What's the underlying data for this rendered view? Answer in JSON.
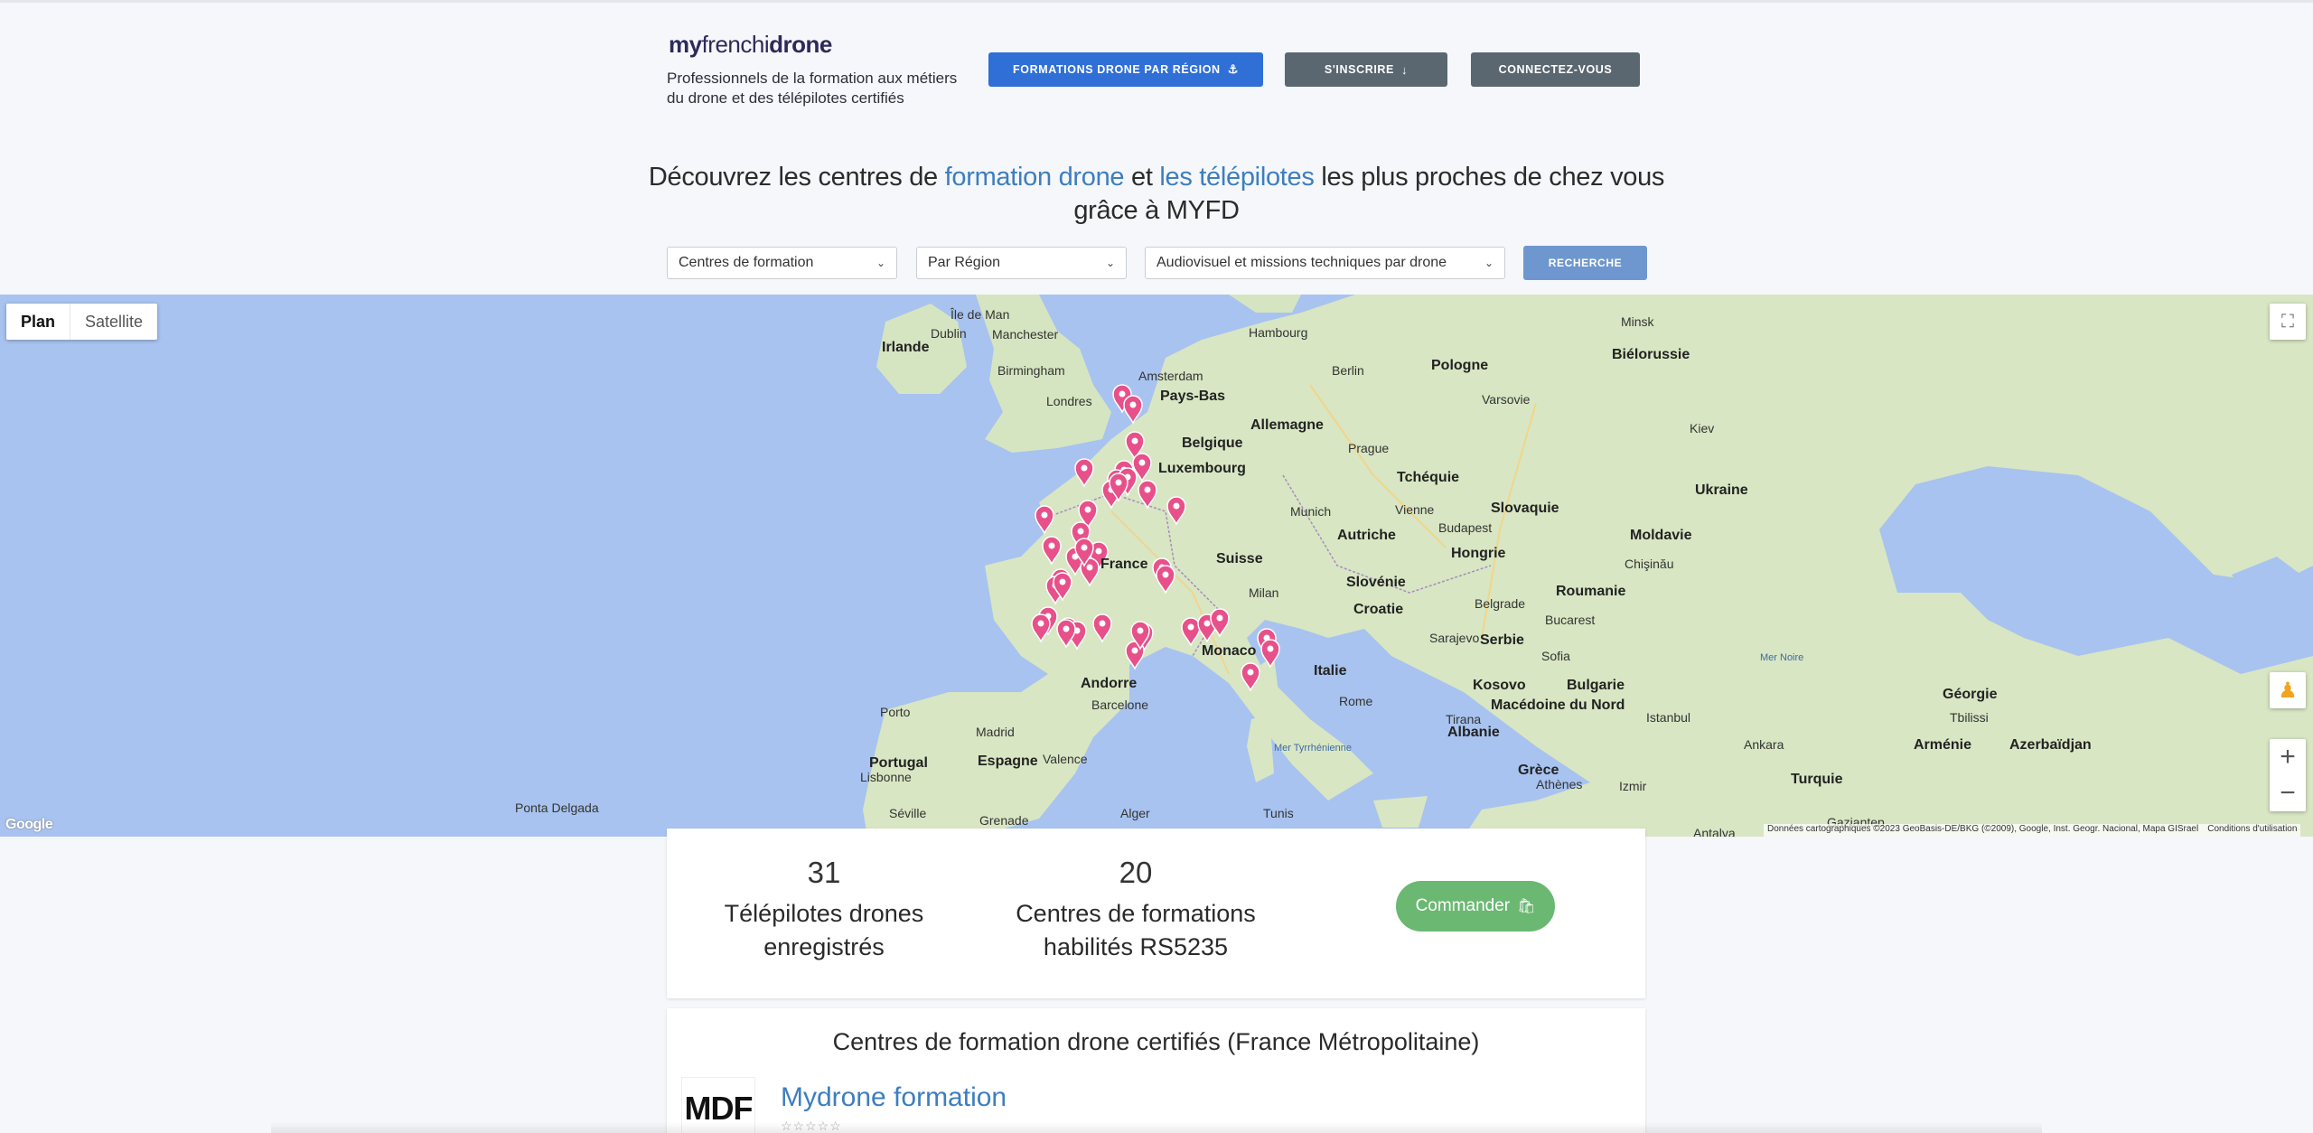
{
  "header": {
    "logo_my": "my",
    "logo_french": "frenchi",
    "logo_drone": "drone",
    "tagline": "Professionnels de la formation aux métiers du drone et des télépilotes certifiés",
    "btn_formations": "FORMATIONS DRONE PAR RÉGION",
    "btn_inscrire": "S'INSCRIRE",
    "btn_connect": "CONNECTEZ-VOUS"
  },
  "headline": {
    "part1": "Découvrez les centres de ",
    "link1": "formation drone",
    "part2": " et ",
    "link2": "les télépilotes",
    "part3": " les plus proches de chez vous grâce à MYFD"
  },
  "filters": {
    "type": "Centres de formation",
    "region": "Par Région",
    "activity": "Audiovisuel et missions techniques par drone",
    "search_label": "RECHERCHE"
  },
  "map": {
    "toggle_plan": "Plan",
    "toggle_satellite": "Satellite",
    "google": "Google",
    "attribution": "Données cartographiques ©2023 GeoBasis-DE/BKG (©2009), Google, Inst. Geogr. Nacional, Mapa GISrael",
    "terms": "Conditions d'utilisation",
    "labels": [
      {
        "t": "Île de Man"
      },
      {
        "t": "Dublin"
      },
      {
        "t": "Irlande"
      },
      {
        "t": "Manchester"
      },
      {
        "t": "Birmingham"
      },
      {
        "t": "Londres"
      },
      {
        "t": "Amsterdam"
      },
      {
        "t": "Pays-Bas"
      },
      {
        "t": "Hambourg"
      },
      {
        "t": "Berlin"
      },
      {
        "t": "Pologne"
      },
      {
        "t": "Varsovie"
      },
      {
        "t": "Minsk"
      },
      {
        "t": "Biélorussie"
      },
      {
        "t": "Belgique"
      },
      {
        "t": "Allemagne"
      },
      {
        "t": "Luxembourg"
      },
      {
        "t": "Prague"
      },
      {
        "t": "Tchéquie"
      },
      {
        "t": "Kiev"
      },
      {
        "t": "Ukraine"
      },
      {
        "t": "Slovaquie"
      },
      {
        "t": "Munich"
      },
      {
        "t": "Vienne"
      },
      {
        "t": "Autriche"
      },
      {
        "t": "Budapest"
      },
      {
        "t": "Hongrie"
      },
      {
        "t": "Moldavie"
      },
      {
        "t": "France"
      },
      {
        "t": "Suisse"
      },
      {
        "t": "Milan"
      },
      {
        "t": "Slovénie"
      },
      {
        "t": "Croatie"
      },
      {
        "t": "Belgrade"
      },
      {
        "t": "Roumanie"
      },
      {
        "t": "Bucarest"
      },
      {
        "t": "Serbie"
      },
      {
        "t": "Sarajevo"
      },
      {
        "t": "Monaco"
      },
      {
        "t": "Italie"
      },
      {
        "t": "Andorre"
      },
      {
        "t": "Barcelone"
      },
      {
        "t": "Kosovo"
      },
      {
        "t": "Sofia"
      },
      {
        "t": "Bulgarie"
      },
      {
        "t": "Rome"
      },
      {
        "t": "Porto"
      },
      {
        "t": "Madrid"
      },
      {
        "t": "Espagne"
      },
      {
        "t": "Valence"
      },
      {
        "t": "Portugal"
      },
      {
        "t": "Lisbonne"
      },
      {
        "t": "Tirana"
      },
      {
        "t": "Albanie"
      },
      {
        "t": "Macédoine du Nord"
      },
      {
        "t": "Istanbul"
      },
      {
        "t": "Grèce"
      },
      {
        "t": "Athènes"
      },
      {
        "t": "Ankara"
      },
      {
        "t": "Turquie"
      },
      {
        "t": "Izmir"
      },
      {
        "t": "Géorgie"
      },
      {
        "t": "Tbilissi"
      },
      {
        "t": "Arménie"
      },
      {
        "t": "Azerbaïdjan"
      },
      {
        "t": "Séville"
      },
      {
        "t": "Grenade"
      },
      {
        "t": "Alger"
      },
      {
        "t": "Tunis"
      },
      {
        "t": "Ponta Delgada"
      },
      {
        "t": "Mer Noire"
      },
      {
        "t": "Mer Tyrrhénienne"
      },
      {
        "t": "Gaziantep"
      },
      {
        "t": "Antalya"
      },
      {
        "t": "Chişinău"
      }
    ],
    "pin_count": 40
  },
  "stats": {
    "pilots_count": "31",
    "pilots_label": "Télépilotes drones enregistrés",
    "centers_count": "20",
    "centers_label": "Centres de formations habilités RS5235",
    "order_label": "Commander"
  },
  "list": {
    "title": "Centres de formation drone certifiés (France Métropolitaine)",
    "items": [
      {
        "logo": "MDF",
        "name": "Mydrone formation",
        "stars": "☆☆☆☆☆"
      }
    ]
  },
  "colors": {
    "primary": "#2f6fd6",
    "grey_button": "#5a6770",
    "link": "#3d7ebf",
    "order": "#6bb872",
    "pin": "#e8508a",
    "sea": "#a8c3ef",
    "land": "#d8e6c3"
  }
}
